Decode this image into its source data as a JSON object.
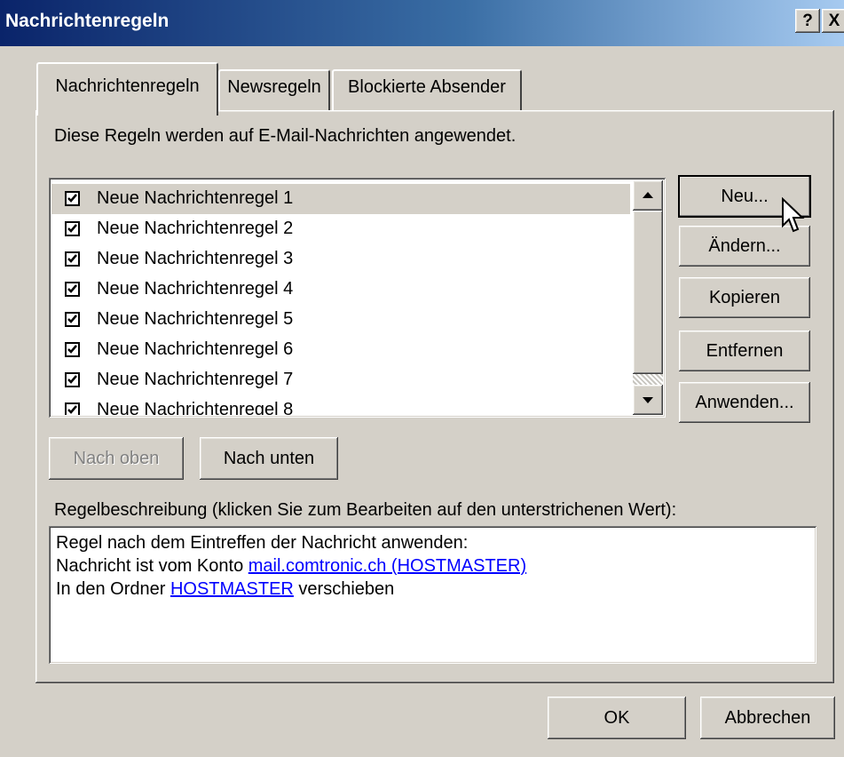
{
  "window": {
    "title": "Nachrichtenregeln",
    "help_glyph": "?",
    "close_glyph": "X"
  },
  "tabs": [
    {
      "label": "Nachrichtenregeln",
      "active": true
    },
    {
      "label": "Newsregeln",
      "active": false
    },
    {
      "label": "Blockierte Absender",
      "active": false
    }
  ],
  "description": "Diese Regeln werden auf E-Mail-Nachrichten angewendet.",
  "rules": [
    {
      "label": "Neue Nachrichtenregel 1",
      "checked": true,
      "selected": true
    },
    {
      "label": "Neue Nachrichtenregel 2",
      "checked": true
    },
    {
      "label": "Neue Nachrichtenregel 3",
      "checked": true
    },
    {
      "label": "Neue Nachrichtenregel 4",
      "checked": true
    },
    {
      "label": "Neue Nachrichtenregel 5",
      "checked": true
    },
    {
      "label": "Neue Nachrichtenregel 6",
      "checked": true
    },
    {
      "label": "Neue Nachrichtenregel 7",
      "checked": true
    },
    {
      "label": "Neue Nachrichtenregel 8",
      "checked": true
    }
  ],
  "side_buttons": {
    "new": "Neu...",
    "edit": "Ändern...",
    "copy": "Kopieren",
    "remove": "Entfernen",
    "apply": "Anwenden..."
  },
  "move_buttons": {
    "up": "Nach oben",
    "down": "Nach unten",
    "up_disabled": true
  },
  "rule_description": {
    "label": "Regelbeschreibung (klicken Sie zum Bearbeiten auf den unterstrichenen Wert):",
    "line1": "Regel nach dem Eintreffen der Nachricht anwenden:",
    "line2_prefix": "Nachricht ist vom Konto ",
    "line2_link": "mail.comtronic.ch (HOSTMASTER)",
    "line3_prefix": "In den Ordner ",
    "line3_link": "HOSTMASTER",
    "line3_suffix": " verschieben"
  },
  "footer": {
    "ok": "OK",
    "cancel": "Abbrechen"
  },
  "colors": {
    "title_gradient_start": "#0a246a",
    "title_gradient_end": "#a6caf0",
    "dialog_face": "#d4d0c8",
    "link": "#0000ff"
  }
}
